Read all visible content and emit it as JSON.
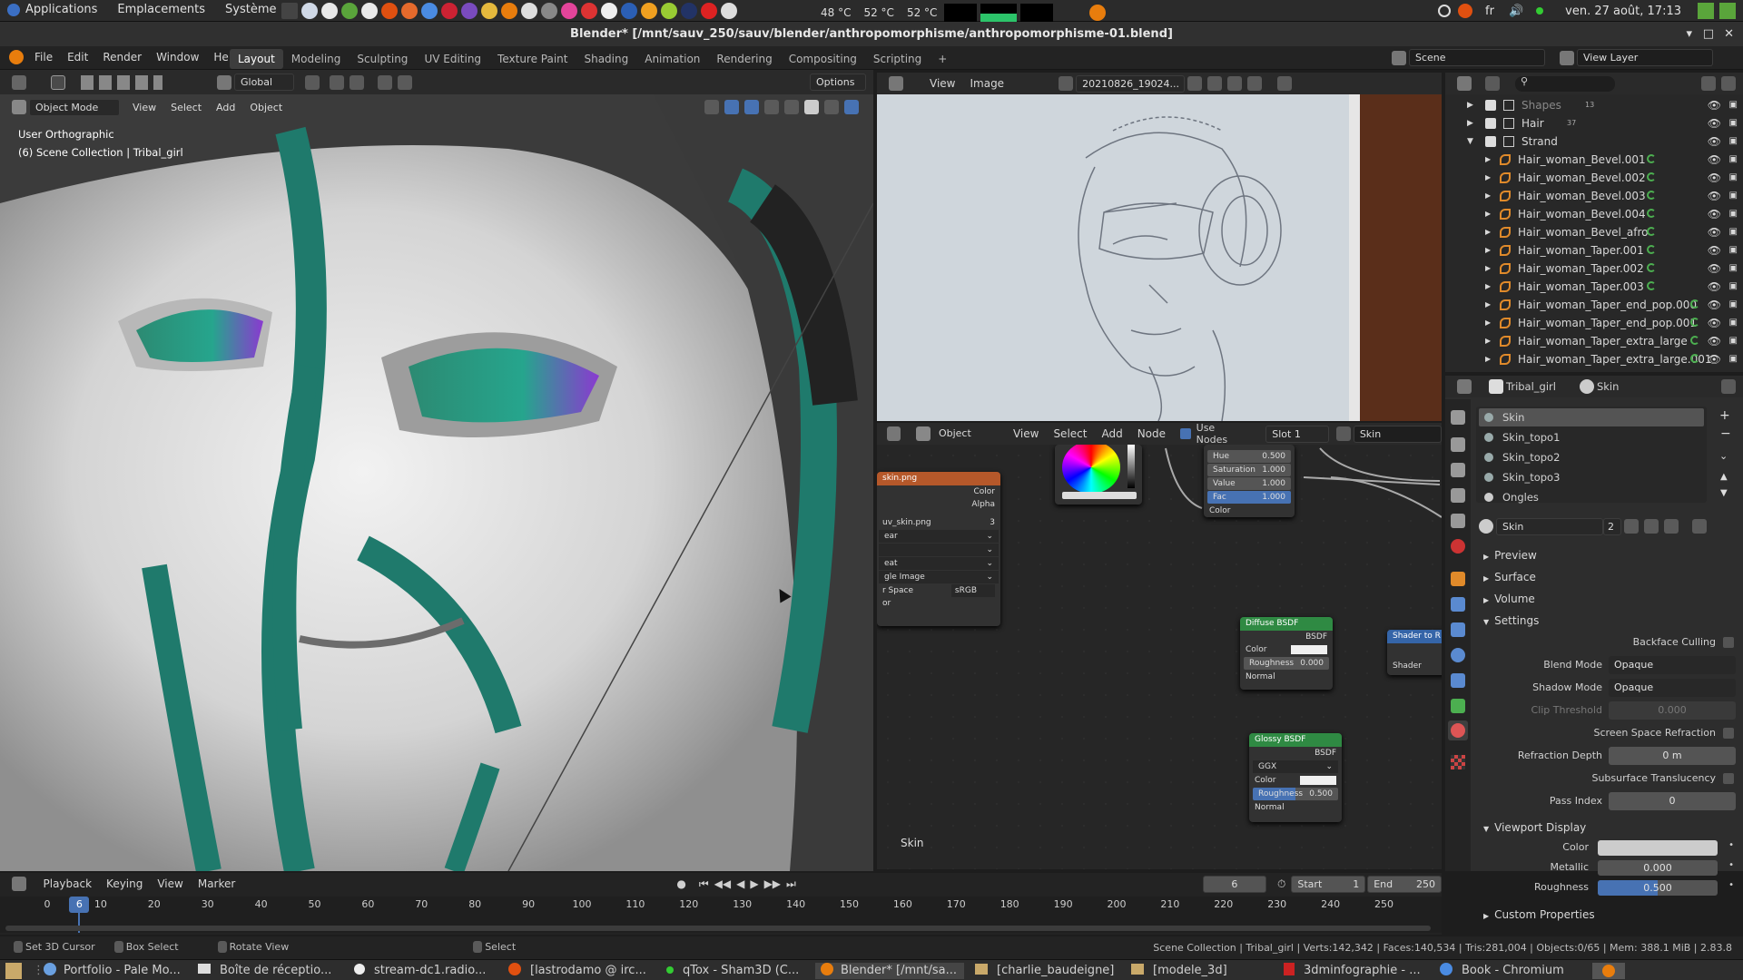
{
  "system": {
    "menus": [
      "Applications",
      "Emplacements",
      "Système"
    ],
    "temps": [
      "48 °C",
      "52 °C",
      "52 °C"
    ],
    "lang": "fr",
    "datetime": "ven. 27 août, 17:13"
  },
  "window": {
    "title": "Blender* [/mnt/sauv_250/sauv/blender/anthropomorphisme/anthropomorphisme-01.blend]"
  },
  "topbar": {
    "menus": [
      "File",
      "Edit",
      "Render",
      "Window",
      "Help"
    ],
    "workspaces": [
      "Layout",
      "Modeling",
      "Sculpting",
      "UV Editing",
      "Texture Paint",
      "Shading",
      "Animation",
      "Rendering",
      "Compositing",
      "Scripting"
    ],
    "active_workspace": "Layout",
    "scene": "Scene",
    "view_layer": "View Layer"
  },
  "viewport": {
    "transform": "Global",
    "options": "Options",
    "mode": "Object Mode",
    "menus": [
      "View",
      "Select",
      "Add",
      "Object"
    ],
    "overlay_line1": "User Orthographic",
    "overlay_line2": "(6) Scene Collection | Tribal_girl"
  },
  "image_editor": {
    "menus": [
      "View",
      "Image"
    ],
    "image_name": "20210826_19024..."
  },
  "node_editor": {
    "type": "Object",
    "menus": [
      "View",
      "Select",
      "Add",
      "Node"
    ],
    "use_nodes": "Use Nodes",
    "slot": "Slot 1",
    "material": "Skin",
    "footer_label": "Skin",
    "image_node": {
      "title": "skin.png",
      "out_color": "Color",
      "out_alpha": "Alpha",
      "image": "uv_skin.png",
      "users": "3",
      "rows": [
        "ear",
        "",
        "eat",
        "gle Image"
      ],
      "space_label": "r Space",
      "space_value": "sRGB",
      "last": "or"
    },
    "hsv_node": {
      "rows": [
        {
          "label": "Hue",
          "value": "0.500"
        },
        {
          "label": "Saturation",
          "value": "1.000"
        },
        {
          "label": "Value",
          "value": "1.000"
        },
        {
          "label": "Fac",
          "value": "1.000"
        }
      ],
      "color": "Color"
    },
    "diffuse_node": {
      "title": "Diffuse BSDF",
      "out": "BSDF",
      "color": "Color",
      "roughness_label": "Roughness",
      "roughness": "0.000",
      "normal": "Normal"
    },
    "glossy_node": {
      "title": "Glossy BSDF",
      "out": "BSDF",
      "dist": "GGX",
      "color": "Color",
      "roughness_label": "Roughness",
      "roughness": "0.500",
      "normal": "Normal"
    },
    "shader_rgb_node": {
      "title": "Shader to R",
      "in": "Shader"
    }
  },
  "outliner": {
    "rows": [
      {
        "name": "Shapes",
        "badge": "13",
        "level": 1
      },
      {
        "name": "Hair",
        "badge": "37",
        "level": 1
      },
      {
        "name": "Strand",
        "badge": "",
        "level": 1
      },
      {
        "name": "Hair_woman_Bevel.001",
        "level": 2
      },
      {
        "name": "Hair_woman_Bevel.002",
        "level": 2
      },
      {
        "name": "Hair_woman_Bevel.003",
        "level": 2
      },
      {
        "name": "Hair_woman_Bevel.004",
        "level": 2
      },
      {
        "name": "Hair_woman_Bevel_afro",
        "level": 2
      },
      {
        "name": "Hair_woman_Taper.001",
        "level": 2
      },
      {
        "name": "Hair_woman_Taper.002",
        "level": 2
      },
      {
        "name": "Hair_woman_Taper.003",
        "level": 2
      },
      {
        "name": "Hair_woman_Taper_end_pop.000",
        "level": 2
      },
      {
        "name": "Hair_woman_Taper_end_pop.001",
        "level": 2
      },
      {
        "name": "Hair_woman_Taper_extra_large",
        "level": 2
      },
      {
        "name": "Hair_woman_Taper_extra_large.001",
        "level": 2
      }
    ]
  },
  "properties": {
    "object": "Tribal_girl",
    "material": "Skin",
    "slots": [
      "Skin",
      "Skin_topo1",
      "Skin_topo2",
      "Skin_topo3",
      "Ongles"
    ],
    "datablock": "Skin",
    "users": "2",
    "panels": [
      "Preview",
      "Surface",
      "Volume",
      "Settings"
    ],
    "settings": {
      "backface_culling": "Backface Culling",
      "blend_mode_label": "Blend Mode",
      "blend_mode": "Opaque",
      "shadow_mode_label": "Shadow Mode",
      "shadow_mode": "Opaque",
      "clip_threshold_label": "Clip Threshold",
      "clip_threshold": "0.000",
      "ssr": "Screen Space Refraction",
      "refraction_depth_label": "Refraction Depth",
      "refraction_depth": "0 m",
      "sss": "Subsurface Translucency",
      "pass_index_label": "Pass Index",
      "pass_index": "0"
    },
    "viewport_display": {
      "title": "Viewport Display",
      "color_label": "Color",
      "metallic_label": "Metallic",
      "metallic": "0.000",
      "roughness_label": "Roughness",
      "roughness": "0.500",
      "roughness_fraction": 0.5
    },
    "custom_props": "Custom Properties"
  },
  "timeline": {
    "menus": [
      "Playback",
      "Keying",
      "View",
      "Marker"
    ],
    "current_frame": "6",
    "start_label": "Start",
    "start": "1",
    "end_label": "End",
    "end": "250",
    "ticks": [
      "0",
      "10",
      "20",
      "30",
      "40",
      "50",
      "60",
      "70",
      "80",
      "90",
      "100",
      "110",
      "120",
      "130",
      "140",
      "150",
      "160",
      "170",
      "180",
      "190",
      "200",
      "210",
      "220",
      "230",
      "240",
      "250"
    ]
  },
  "status": {
    "hints": [
      "Set 3D Cursor",
      "Box Select",
      "Rotate View",
      "Select"
    ],
    "info": "Scene Collection | Tribal_girl | Verts:142,342 | Faces:140,534 | Tris:281,004 | Objects:0/65 | Mem: 388.1 MiB | 2.83.8"
  },
  "taskbar": {
    "tasks": [
      "Portfolio - Pale Mo...",
      "Boîte de réceptio...",
      "stream-dc1.radio...",
      "[lastrodamo @ irc...",
      "qTox - Sham3D (C...",
      "Blender* [/mnt/sa...",
      "[charlie_baudeigne]",
      "[modele_3d]",
      "3dminfographie - ...",
      "Book - Chromium"
    ],
    "active_task": "Blender* [/mnt/sa..."
  },
  "colors": {
    "accent": "#4772b3",
    "teal": "#1f7a6c",
    "node_image": "#b5582a",
    "node_shader": "#2f8a43"
  }
}
